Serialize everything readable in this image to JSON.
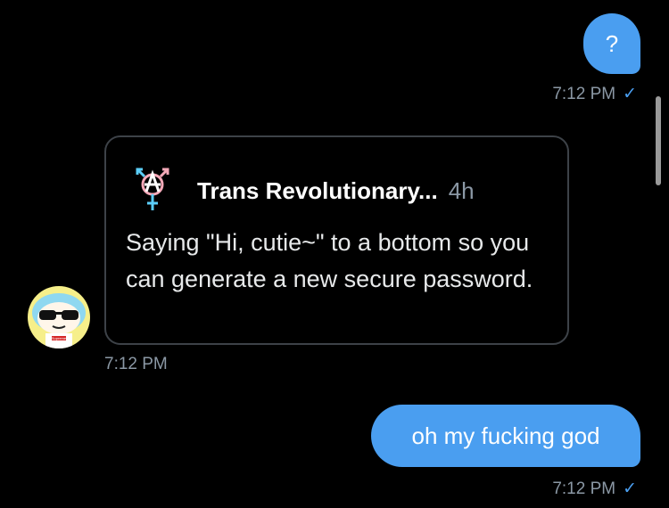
{
  "messages": {
    "sent_first": {
      "text": "?",
      "time": "7:12 PM",
      "status_icon": "✓"
    },
    "received_card": {
      "author": "Trans Revolutionary...",
      "age": "4h",
      "text": "Saying \"Hi, cutie~\" to a bottom so you can generate a new secure password.",
      "time": "7:12 PM",
      "logo_icon": "trans-anarchy-symbol-icon",
      "avatar_icon": "sunglasses-character-avatar-icon",
      "avatar_badge_text": "Supreme"
    },
    "sent_last": {
      "text": "oh my fucking god",
      "time": "7:12 PM",
      "status_icon": "✓"
    }
  },
  "colors": {
    "background": "#000000",
    "sent_bubble": "#4a9ef0",
    "timestamp": "#8b98a5",
    "card_border": "#3d4248",
    "trans_blue": "#5bcefa",
    "trans_pink": "#f5a9b8"
  }
}
